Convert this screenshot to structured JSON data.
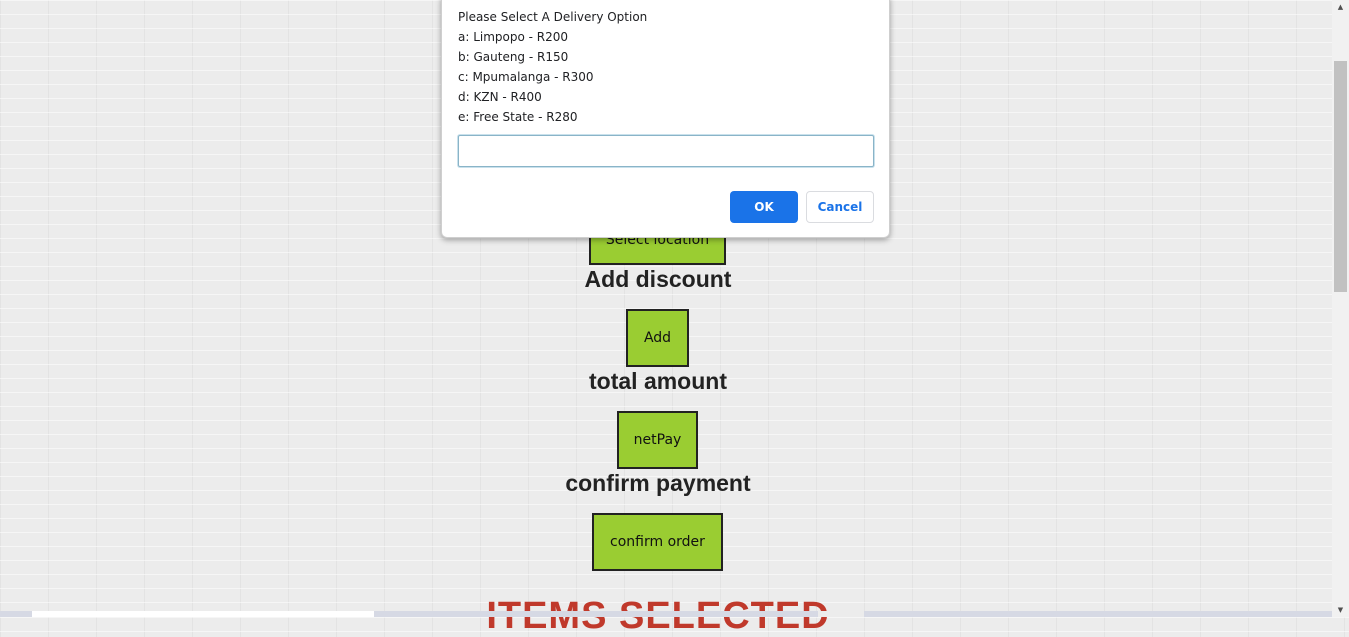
{
  "page": {
    "location_button_label": "Select location",
    "discount_heading": "Add discount",
    "discount_button_label": "Add",
    "total_heading": "total amount",
    "total_button_label": "netPay",
    "confirm_heading": "confirm payment",
    "confirm_button_label": "confirm order",
    "items_heading": "ITEMS SELECTED"
  },
  "dialog": {
    "title": "Please Select A Delivery Option",
    "options": [
      "a: Limpopo - R200",
      "b: Gauteng - R150",
      "c: Mpumalanga - R300",
      "d: KZN - R400",
      "e: Free State - R280"
    ],
    "input_value": "",
    "ok_label": "OK",
    "cancel_label": "Cancel"
  },
  "colors": {
    "button_green": "#9acd32",
    "items_heading_red": "#c0392b",
    "ok_blue": "#1a73e8"
  },
  "icons": {
    "scroll_up": "▲",
    "scroll_down": "▼"
  }
}
